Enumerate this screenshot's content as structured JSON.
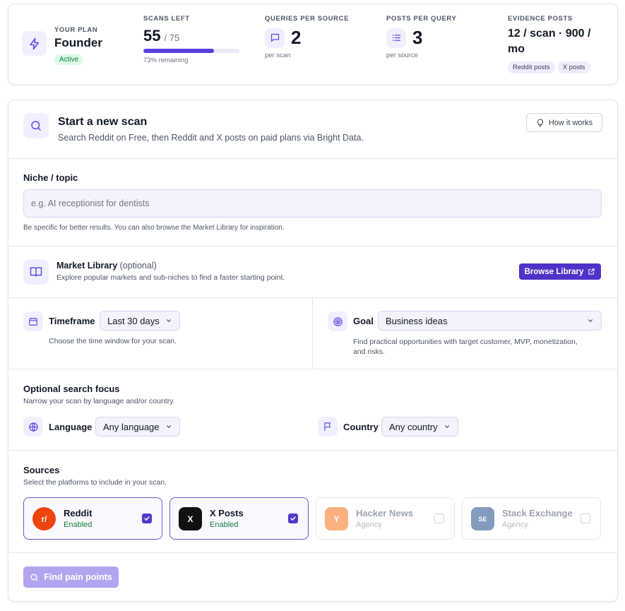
{
  "plan": {
    "eyebrow": "YOUR PLAN",
    "name": "Founder",
    "status": "Active"
  },
  "scans_left": {
    "eyebrow": "SCANS LEFT",
    "value": "55",
    "total": "/ 75",
    "remaining_text": "73% remaining",
    "progress_fraction": 0.733
  },
  "queries_per_source": {
    "eyebrow": "QUERIES PER SOURCE",
    "value": "2",
    "sub": "per scan"
  },
  "posts_per_query": {
    "eyebrow": "POSTS PER QUERY",
    "value": "3",
    "sub": "per source"
  },
  "evidence_posts": {
    "eyebrow": "EVIDENCE POSTS",
    "value_line1": "12 / scan · 900 /",
    "value_line2": "mo",
    "tags": [
      "Reddit posts",
      "X posts"
    ]
  },
  "scan": {
    "title": "Start a new scan",
    "subtitle": "Search Reddit on Free, then Reddit and X posts on paid plans via Bright Data.",
    "how_it_works": "How it works"
  },
  "niche": {
    "label": "Niche / topic",
    "placeholder": "e.g. AI receptionist for dentists",
    "value": "",
    "helper": "Be specific for better results. You can also browse the Market Library for inspiration."
  },
  "market_library": {
    "title": "Market Library",
    "optional": "(optional)",
    "description": "Explore popular markets and sub-niches to find a faster starting point.",
    "button": "Browse Library"
  },
  "timeframe": {
    "label": "Timeframe",
    "value": "Last 30 days",
    "helper": "Choose the time window for your scan."
  },
  "goal": {
    "label": "Goal",
    "value": "Business ideas",
    "helper_line1": "Find practical opportunities with target customer, MVP, monetization,",
    "helper_line2": "and risks."
  },
  "search_focus": {
    "title": "Optional search focus",
    "description": "Narrow your scan by language and/or country.",
    "language_label": "Language",
    "language_value": "Any language",
    "country_label": "Country",
    "country_value": "Any country"
  },
  "sources": {
    "title": "Sources",
    "description": "Select the platforms to include in your scan.",
    "items": [
      {
        "name": "Reddit",
        "status": "Enabled",
        "logo": "r/",
        "color": "#f0440f",
        "checked": true
      },
      {
        "name": "X Posts",
        "status": "Enabled",
        "logo": "X",
        "color": "#111111",
        "checked": true
      },
      {
        "name": "Hacker News",
        "status": "Agency",
        "logo": "Y",
        "color": "#f97316",
        "checked": false
      },
      {
        "name": "Stack Exchange",
        "status": "Agency",
        "logo": "SE",
        "color": "#1e4a8a",
        "checked": false
      }
    ]
  },
  "submit": {
    "label": "Find pain points"
  },
  "colors": {
    "accent": "#5b3de0",
    "accent_light": "#f0efff",
    "enabled_green": "#15803d"
  },
  "icons": {
    "plan": "lightning-icon",
    "queries": "chat-bubble-icon",
    "posts": "list-icon",
    "scan": "search-icon",
    "how_it_works": "lightbulb-icon",
    "market_library": "book-icon",
    "browse": "external-link-icon",
    "timeframe": "calendar-icon",
    "goal": "target-icon",
    "language": "globe-icon",
    "country": "flag-icon",
    "submit": "search-icon"
  }
}
